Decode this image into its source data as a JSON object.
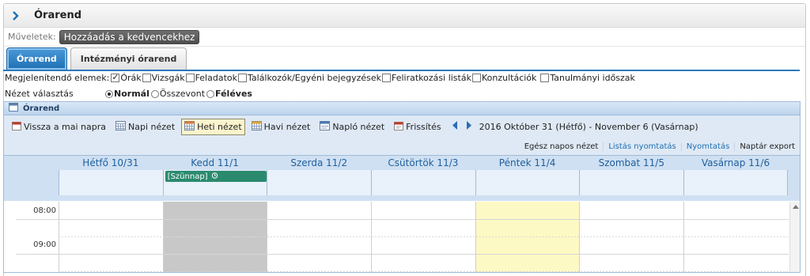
{
  "header": {
    "title": "Órarend"
  },
  "actions": {
    "label": "Műveletek:",
    "favorite_button": "Hozzáadás a kedvencekhez"
  },
  "tabs": [
    {
      "label": "Órarend",
      "active": true
    },
    {
      "label": "Intézményi órarend",
      "active": false
    }
  ],
  "filters": {
    "label": "Megjelenítendő elemek:",
    "items": [
      {
        "label": "Órák",
        "checked": true
      },
      {
        "label": "Vizsgák",
        "checked": false
      },
      {
        "label": "Feladatok",
        "checked": false
      },
      {
        "label": "Találkozók/Egyéni bejegyzések",
        "checked": false
      },
      {
        "label": "Feliratkozási listák",
        "checked": false
      },
      {
        "label": "Konzultációk",
        "checked": false
      },
      {
        "label": "Tanulmányi időszak",
        "checked": false
      }
    ]
  },
  "view_select": {
    "label": "Nézet választás",
    "options": [
      {
        "label": "Normál",
        "selected": true
      },
      {
        "label": "Összevont",
        "selected": false
      },
      {
        "label": "Féléves",
        "selected": false
      }
    ]
  },
  "calendar": {
    "title": "Órarend",
    "toolbar": {
      "today": "Vissza a mai napra",
      "day": "Napi nézet",
      "week": "Heti nézet",
      "month": "Havi nézet",
      "log": "Napló nézet",
      "refresh": "Frissítés",
      "range": "2016 Október 31 (Hétfő) - November 6 (Vasárnap)"
    },
    "toolbar2": {
      "allday": "Egész napos nézet",
      "list_print": "Listás nyomtatás",
      "print": "Nyomtatás",
      "export": "Naptár export"
    },
    "days": [
      "Hétfő 10/31",
      "Kedd 11/1",
      "Szerda 11/2",
      "Csütörtök 11/3",
      "Péntek 11/4",
      "Szombat 11/5",
      "Vasárnap 11/6"
    ],
    "allday_event": {
      "label": "[Szünnap]"
    },
    "times": [
      "08:00",
      "09:00"
    ]
  },
  "colors": {
    "accent": "#1f6fb3",
    "event": "#2b8a6e",
    "today": "#fdf9c4",
    "holiday": "#c8c8c8"
  }
}
